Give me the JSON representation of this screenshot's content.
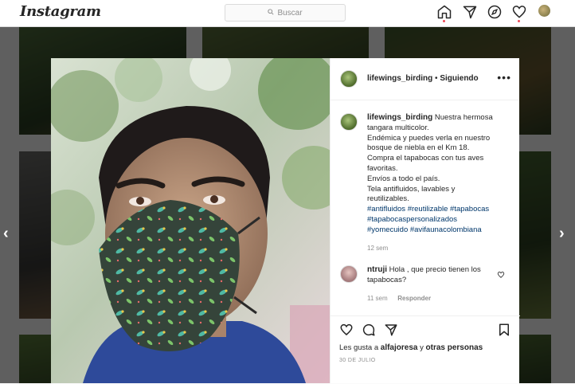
{
  "nav": {
    "logo": "Instagram",
    "search_placeholder": "Buscar",
    "icons": [
      "home-icon",
      "direct-icon",
      "explore-icon",
      "activity-heart-icon",
      "profile-avatar"
    ]
  },
  "post": {
    "username": "lifewings_birding",
    "separator": "•",
    "follow_status": "Siguiendo",
    "more": "•••",
    "caption": {
      "username": "lifewings_birding",
      "line1": "Nuestra hermosa",
      "line2": "tangara multicolor.",
      "line3": "Endémica y puedes verla en nuestro",
      "line4": "bosque de niebla en el Km 18.",
      "line5": "Compra el tapabocas con tus aves",
      "line6": "favoritas.",
      "line7": "Envíos a todo el país.",
      "line8": "Tela antifluidos, lavables y",
      "line9": "reutilizables.",
      "hashtags1": "#antifluidos #reutilizable #tapabocas",
      "hashtags2": "#tapabocaspersonalizados",
      "hashtags3": "#yomecuido #avifaunacolombiana",
      "time": "12 sem"
    },
    "comment": {
      "username": "ntruji",
      "text_line1": "Hola , que precio tienen los",
      "text_line2": "tapabocas?",
      "time": "11 sem",
      "reply": "Responder"
    },
    "likes_prefix": "Les gusta a",
    "likes_user": "alfajoresa",
    "likes_suffix": "y",
    "likes_others": "otras personas",
    "date": "30 DE JULIO"
  },
  "arrows": {
    "prev": "‹",
    "next": "›"
  },
  "colors": {
    "accent_dot": "#ed4956",
    "link": "#00376b",
    "muted": "#8e8e8e"
  }
}
